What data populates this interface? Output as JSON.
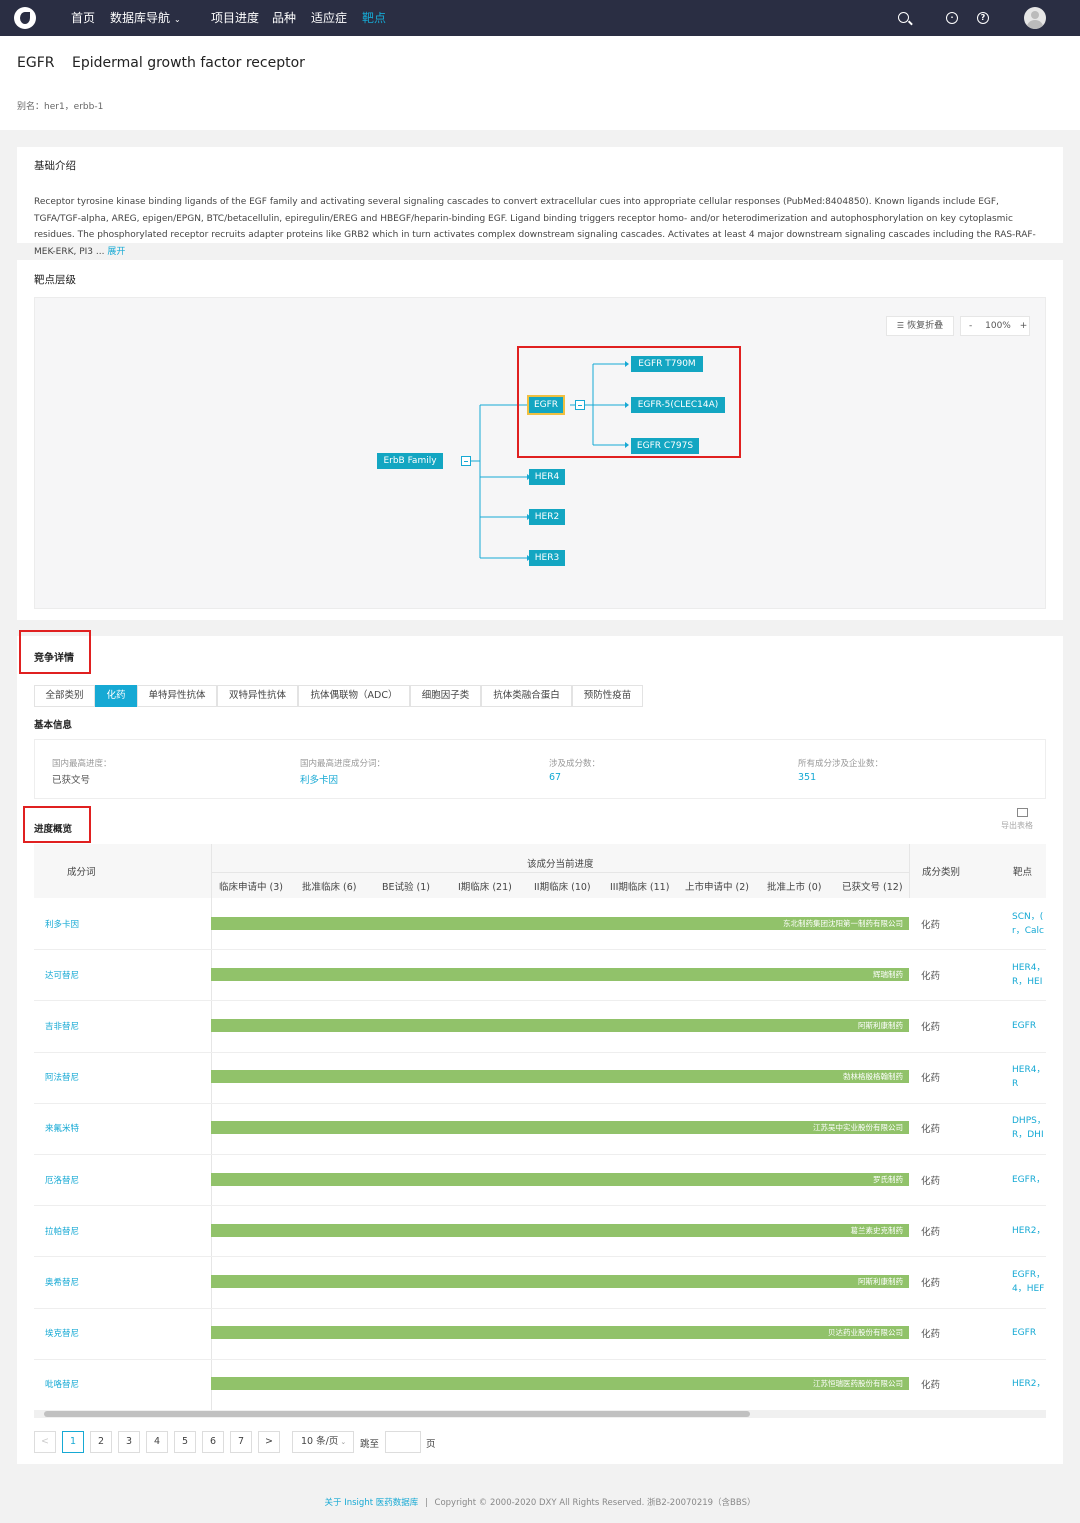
{
  "nav": {
    "items": [
      "首页",
      "数据库导航",
      "项目进度",
      "品种",
      "适应症",
      "靶点"
    ],
    "active": "靶点",
    "icons": [
      "search-icon",
      "bulb-icon",
      "help-icon",
      "avatar"
    ]
  },
  "header": {
    "symbol": "EGFR",
    "name": "Epidermal growth factor receptor",
    "aliases": "别名：her1，erbb-1"
  },
  "intro": {
    "title": "基础介绍",
    "text": "Receptor tyrosine kinase binding ligands of the EGF family and activating several signaling cascades to convert extracellular cues into appropriate cellular responses (PubMed:8404850). Known ligands include EGF, TGFA/TGF-alpha, AREG, epigen/EPGN, BTC/betacellulin, epiregulin/EREG and HBEGF/heparin-binding EGF. Ligand binding triggers receptor homo- and/or heterodimerization and autophosphorylation on key cytoplasmic residues. The phosphorylated receptor recruits adapter proteins like GRB2 which in turn activates complex downstream signaling cascades. Activates at least 4 major downstream signaling cascades including the RAS-RAF-MEK-ERK, PI3 ...",
    "more": "展开"
  },
  "hierarchy": {
    "title": "靶点层级",
    "restore_label": "恢复折叠",
    "zoom_minus": "-",
    "zoom": "100%",
    "zoom_plus": "+",
    "root": "ErbB Family",
    "children": [
      "EGFR",
      "HER4",
      "HER2",
      "HER3"
    ],
    "egfr_children": [
      "EGFR T790M",
      "EGFR-5(CLEC14A)",
      "EGFR C797S"
    ]
  },
  "competition": {
    "title": "竞争详情",
    "tabs": [
      "全部类别",
      "化药",
      "单特异性抗体",
      "双特异性抗体",
      "抗体偶联物（ADC）",
      "细胞因子类",
      "抗体类融合蛋白",
      "预防性疫苗"
    ],
    "active_tab": "化药",
    "basic_title": "基本信息",
    "stats": [
      {
        "label": "国内最高进度：",
        "value": "已获文号"
      },
      {
        "label": "国内最高进度成分词：",
        "value": "利多卡因"
      },
      {
        "label": "涉及成分数：",
        "value": "67"
      },
      {
        "label": "所有成分涉及企业数：",
        "value": "351"
      }
    ]
  },
  "progress": {
    "title": "进度概览",
    "export_label": "导出表格",
    "col_name": "成分词",
    "col_group": "该成分当前进度",
    "stages": [
      "临床申请中 (3)",
      "批准临床 (6)",
      "BE试验 (1)",
      "I期临床 (21)",
      "II期临床 (10)",
      "III期临床 (11)",
      "上市申请中 (2)",
      "批准上市 (0)",
      "已获文号 (12)"
    ],
    "col_type": "成分类别",
    "col_target": "靶点",
    "rows": [
      {
        "name": "利多卡因",
        "company": "东北制药集团沈阳第一制药有限公司",
        "type": "化药",
        "target1": "SCN，(",
        "target2": "r，Calc",
        "progress": 1.0
      },
      {
        "name": "达可替尼",
        "company": "辉瑞制药",
        "type": "化药",
        "target1": "HER4，",
        "target2": "R，HEI",
        "progress": 1.0
      },
      {
        "name": "吉非替尼",
        "company": "阿斯利康制药",
        "type": "化药",
        "target1": "EGFR",
        "target2": "",
        "progress": 1.0
      },
      {
        "name": "阿法替尼",
        "company": "勃林格殷格翰制药",
        "type": "化药",
        "target1": "HER4，",
        "target2": "R",
        "progress": 1.0
      },
      {
        "name": "来氟米特",
        "company": "江苏吴中实业股份有限公司",
        "type": "化药",
        "target1": "DHPS，",
        "target2": "R，DHI",
        "progress": 1.0
      },
      {
        "name": "厄洛替尼",
        "company": "罗氏制药",
        "type": "化药",
        "target1": "EGFR，",
        "target2": "",
        "progress": 1.0
      },
      {
        "name": "拉帕替尼",
        "company": "葛兰素史克制药",
        "type": "化药",
        "target1": "HER2，",
        "target2": "",
        "progress": 1.0
      },
      {
        "name": "奥希替尼",
        "company": "阿斯利康制药",
        "type": "化药",
        "target1": "EGFR，",
        "target2": "4，HEF",
        "progress": 1.0
      },
      {
        "name": "埃克替尼",
        "company": "贝达药业股份有限公司",
        "type": "化药",
        "target1": "EGFR",
        "target2": "",
        "progress": 1.0
      },
      {
        "name": "吡咯替尼",
        "company": "江苏恒瑞医药股份有限公司",
        "type": "化药",
        "target1": "HER2，",
        "target2": "",
        "progress": 1.0
      }
    ]
  },
  "pagination": {
    "prev": "<",
    "pages": [
      "1",
      "2",
      "3",
      "4",
      "5",
      "6",
      "7"
    ],
    "current": "1",
    "next": ">",
    "page_size": "10 条/页",
    "jump_label": "跳至",
    "jump_unit": "页"
  },
  "footer": {
    "link": "关于 Insight 医药数据库",
    "sep": "|",
    "copyright": "Copyright © 2000-2020 DXY All Rights Reserved. 浙B2-20070219（含BBS）"
  },
  "colors": {
    "accent": "#16a9d4",
    "nav_bg": "#2a2e43",
    "bar": "#91c26a",
    "highlight": "#e02020"
  }
}
